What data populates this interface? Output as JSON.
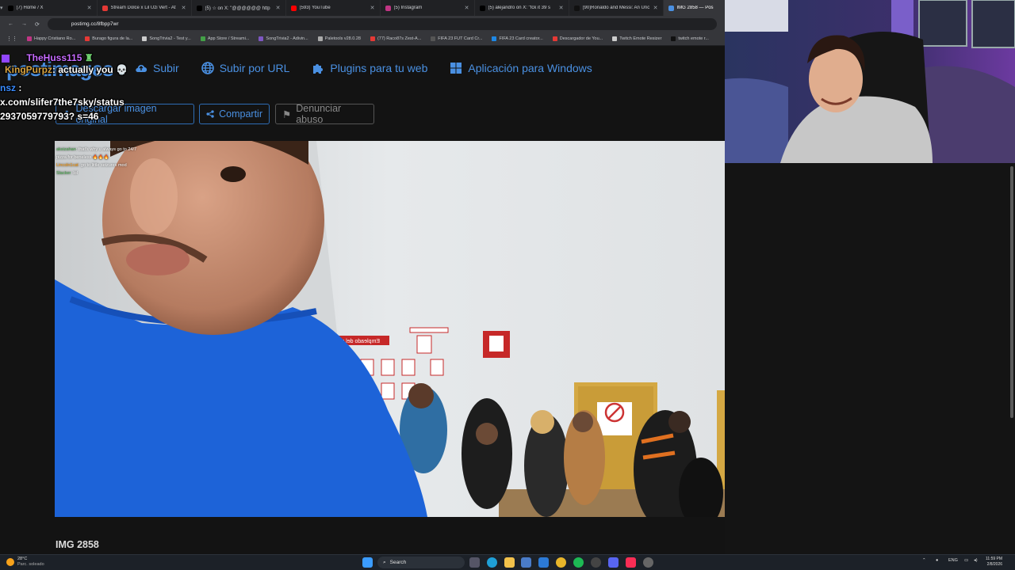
{
  "browser": {
    "tabs": [
      {
        "title": "(7) Home / X",
        "color": "#000000"
      },
      {
        "title": "Stream Dolce x Lil Uzi Vert - At",
        "color": "#e53935"
      },
      {
        "title": "(5) ☆ on X: \"@@@@@@ http",
        "color": "#000000"
      },
      {
        "title": "(593) YouTube",
        "color": "#ff0000"
      },
      {
        "title": "(5) Instagram",
        "color": "#c13584"
      },
      {
        "title": "(5) alejandro on X: \"fck it 39 s",
        "color": "#000000"
      },
      {
        "title": "(90)Ronaldo and Messi: An Unc",
        "color": "#111111"
      },
      {
        "title": "IMG 2858 — Pos",
        "color": "#4a90e2"
      }
    ],
    "url": "postimg.cc/8fbpp7wr",
    "bookmarks": [
      {
        "label": "Happy Cristiano Ro...",
        "color": "#c13584"
      },
      {
        "label": "Burago figura de la...",
        "color": "#e53935"
      },
      {
        "label": "SongTrivia2 - Test y...",
        "color": "#cccccc"
      },
      {
        "label": "App Store / Streami...",
        "color": "#43a047"
      },
      {
        "label": "SongTrivia2 - Adivin...",
        "color": "#7e57c2"
      },
      {
        "label": "Paletools v28.0.28",
        "color": "#aaaaaa"
      },
      {
        "label": "(77) Raco87s Zest-A...",
        "color": "#e53935"
      },
      {
        "label": "FIFA 23 FUT Card Cr...",
        "color": "#555555"
      },
      {
        "label": "FIFA 23 Card creator...",
        "color": "#1e88e5"
      },
      {
        "label": "Descargador de You...",
        "color": "#e53935"
      },
      {
        "label": "Twitch Emote Resizer",
        "color": "#cccccc"
      },
      {
        "label": "twitch emote r...",
        "color": "#111111"
      }
    ]
  },
  "site": {
    "logo": "postimages",
    "nav": [
      "Subir",
      "Subir por URL",
      "Plugins para tu web",
      "Aplicación para Windows"
    ],
    "actions": {
      "download": "Descargar imagen original",
      "share": "Compartir",
      "report": "Denunciar abuso"
    },
    "image_title": "IMG 2858"
  },
  "photo_sign": "Empleado del mes",
  "photo_chat": [
    {
      "user": "aksizahan",
      "text": ": that's why u always go to 24/7 pizza for beneless 🔥🔥🔥"
    },
    {
      "user": "Lincoln1cat",
      "text": ": go to little seizures mod"
    },
    {
      "user": "Slacker",
      "text": ": lol"
    }
  ],
  "overlay_chat": {
    "user1": "TheHuss115",
    "user2": "KingPurpz",
    "msg2": ": actually you",
    "user3": "nsz",
    "msg3a": "x.com/slifer7the7sky/status",
    "msg3b": "2937059779793? s=46"
  },
  "taskbar": {
    "weather_temp": "28°C",
    "weather_desc": "Parc. soleado",
    "search": "Search",
    "lang": "ENG",
    "time": "11:59 PM",
    "date": "2/8/2026"
  }
}
